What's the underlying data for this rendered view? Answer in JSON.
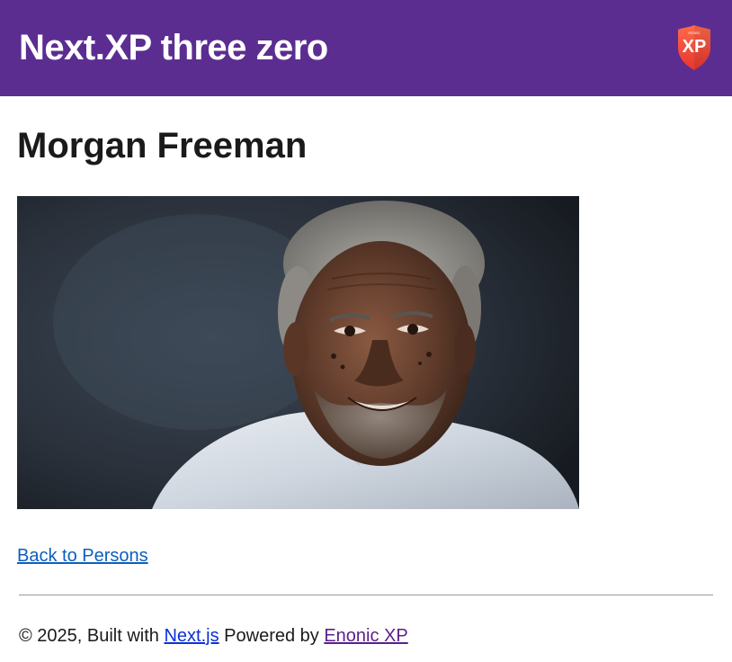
{
  "header": {
    "site_title": "Next.XP three zero",
    "logo_text": "XP",
    "logo_small_text": "enonic",
    "logo_color": "#f0453a",
    "background_color": "#5c2d91"
  },
  "main": {
    "title": "Morgan Freeman",
    "image_alt": "Morgan Freeman",
    "back_link": "Back to Persons"
  },
  "footer": {
    "copyright": "© 2025, Built with ",
    "nextjs_link": "Next.js",
    "powered_by": " Powered by ",
    "enonic_link": "Enonic XP"
  }
}
